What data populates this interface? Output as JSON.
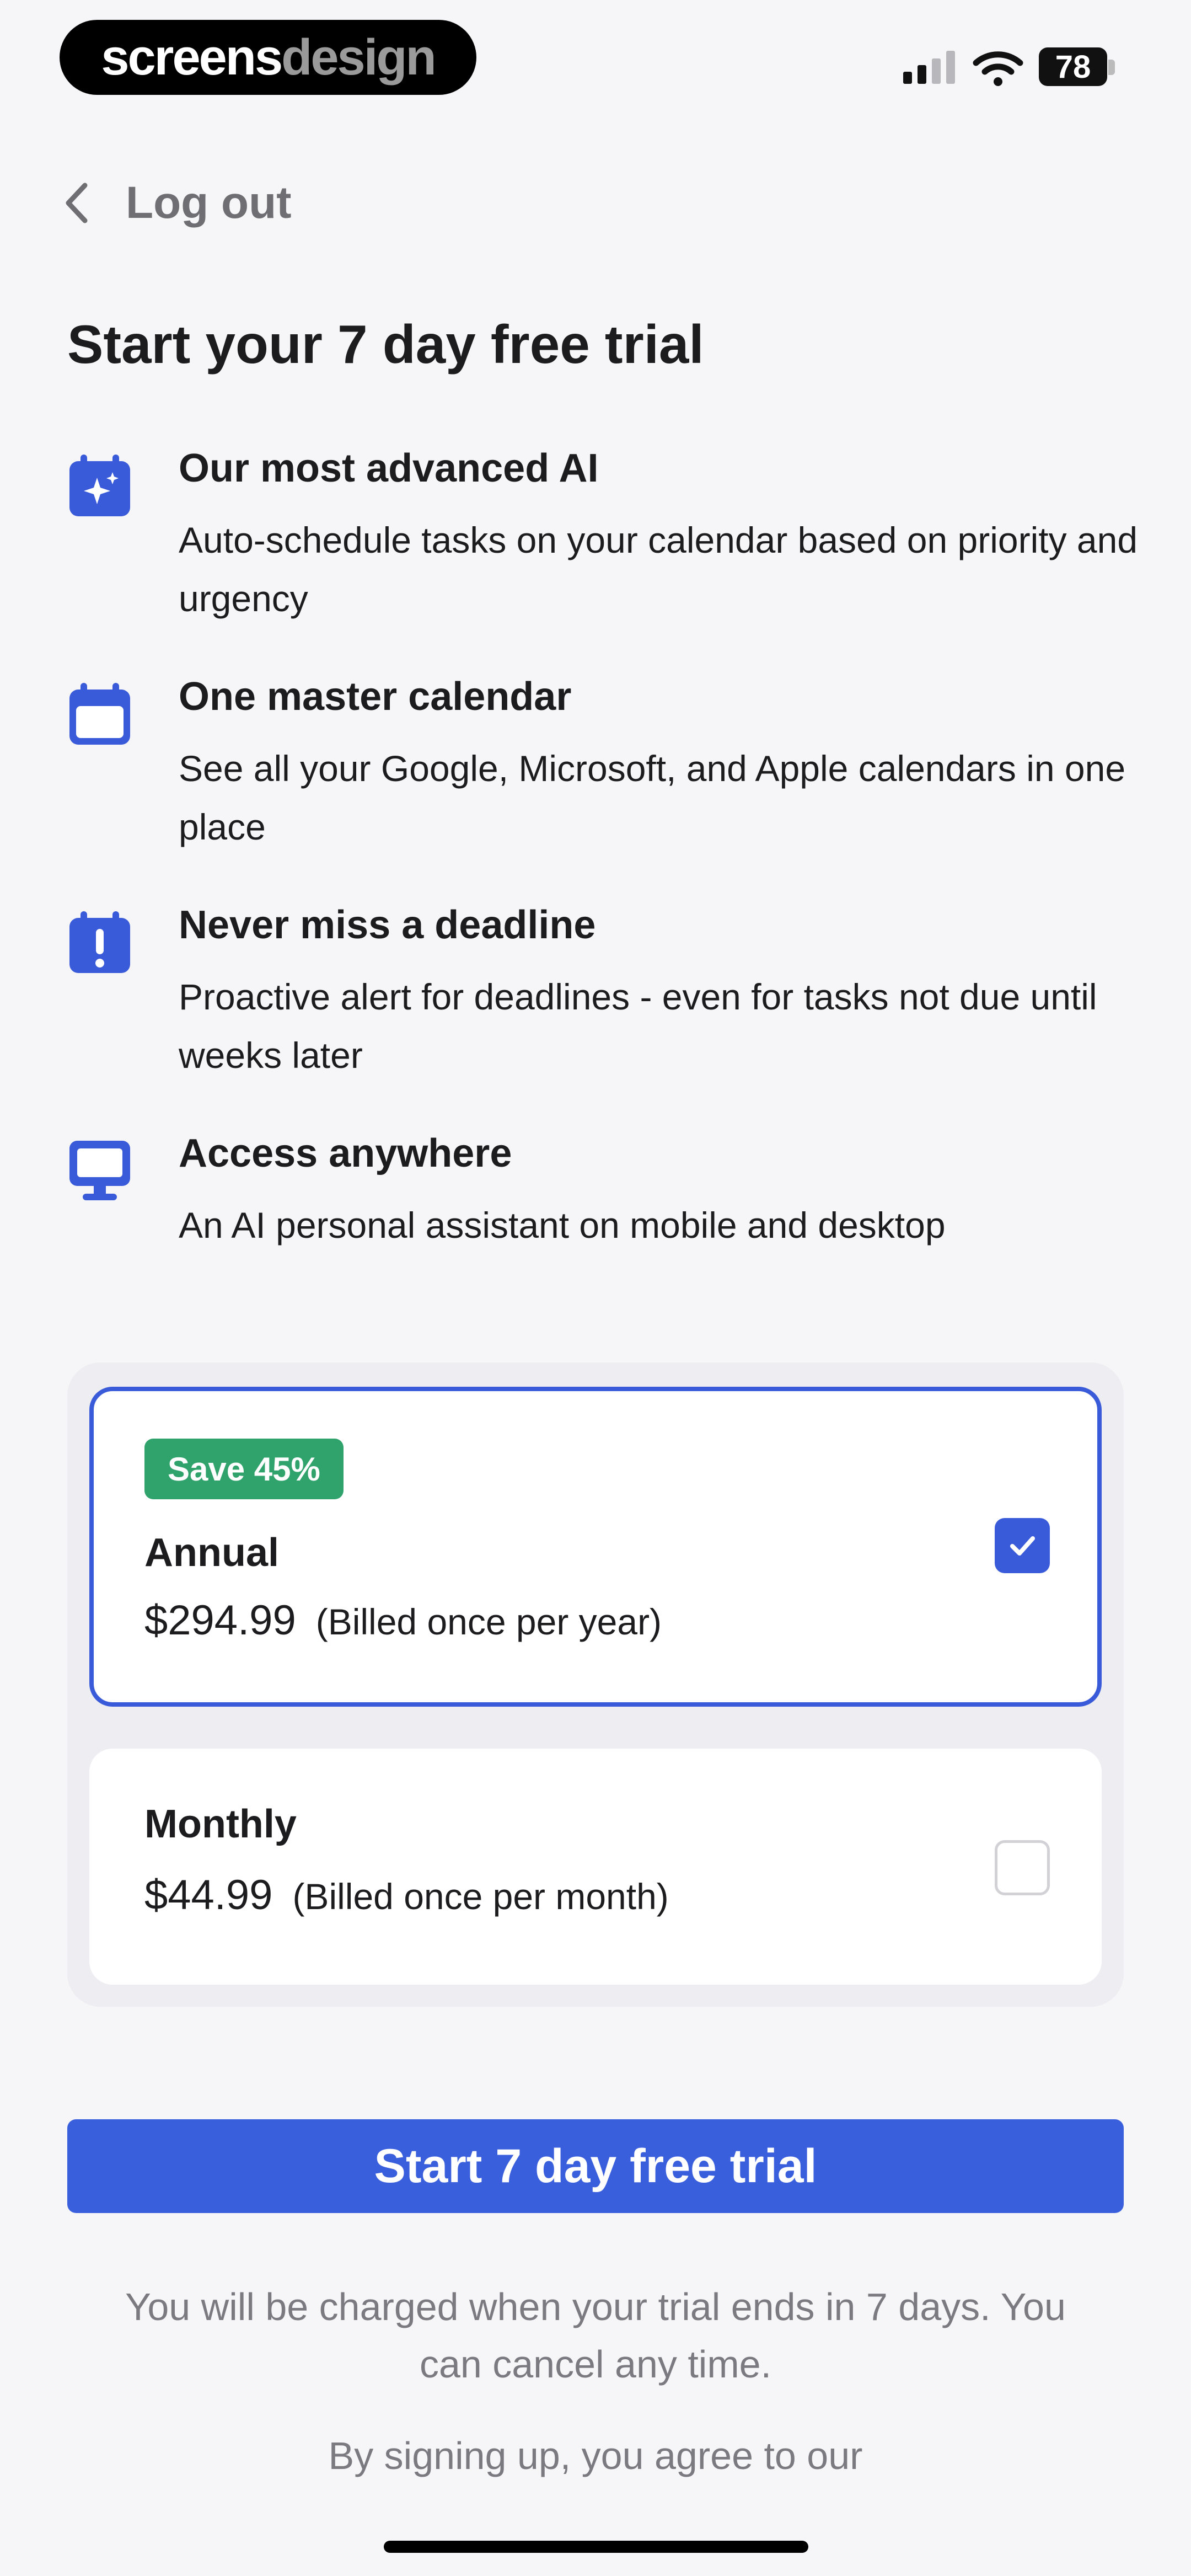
{
  "status_bar": {
    "brand_part1": "screens",
    "brand_part2": "design",
    "battery": "78"
  },
  "nav": {
    "back_label": "Log out"
  },
  "title": "Start your 7 day free trial",
  "features": [
    {
      "icon": "calendar-sparkle-icon",
      "title": "Our most advanced AI",
      "desc": "Auto-schedule tasks on your calendar based on priority and urgency"
    },
    {
      "icon": "calendar-icon",
      "title": "One master calendar",
      "desc": "See all your Google, Microsoft, and Apple calendars in one place"
    },
    {
      "icon": "calendar-alert-icon",
      "title": "Never miss a deadline",
      "desc": "Proactive alert for deadlines - even for tasks not due until weeks later"
    },
    {
      "icon": "desktop-icon",
      "title": "Access anywhere",
      "desc": "An AI personal assistant on mobile and desktop"
    }
  ],
  "plans": {
    "annual": {
      "badge": "Save 45%",
      "name": "Annual",
      "price": "$294.99",
      "billed": "(Billed once per year)",
      "selected": true
    },
    "monthly": {
      "name": "Monthly",
      "price": "$44.99",
      "billed": "(Billed once per month)",
      "selected": false
    }
  },
  "cta": "Start 7 day free trial",
  "note": "You will be charged when your trial ends in 7 days. You can cancel any time.",
  "terms": "By signing up, you agree to our",
  "colors": {
    "accent": "#3a5bd9",
    "badge": "#2fa36b",
    "text": "#1c1c1e",
    "muted": "#7a7a80",
    "background": "#f6f6f8"
  }
}
